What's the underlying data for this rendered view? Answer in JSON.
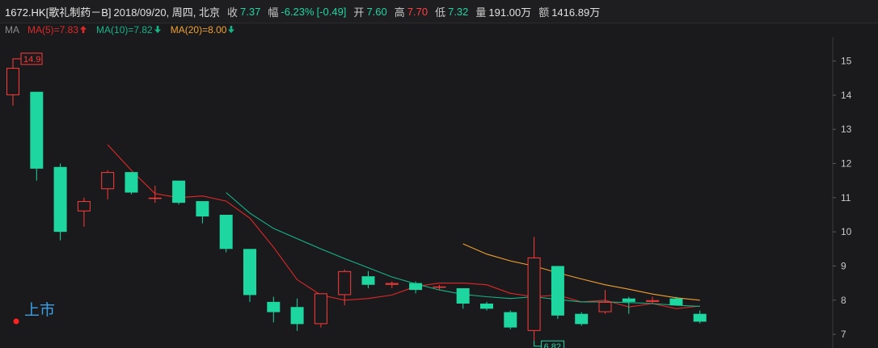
{
  "header": {
    "title": "1672.HK[歌礼制药－B]",
    "date": "2018/09/20, 周四, 北京",
    "close_label": "收",
    "close_value": "7.37",
    "change_label": "幅",
    "change_pct": "-6.23%",
    "change_abs": "[-0.49]",
    "open_label": "开",
    "open_value": "7.60",
    "high_label": "高",
    "high_value": "7.70",
    "low_label": "低",
    "low_value": "7.32",
    "volume_label": "量",
    "volume_value": "191.00万",
    "amount_label": "额",
    "amount_value": "1416.89万"
  },
  "ma_bar": {
    "tag": "MA",
    "ma5": "MA(5)=7.83",
    "ma10": "MA(10)=7.82",
    "ma20": "MA(20)=8.00"
  },
  "colors": {
    "up": "#ff3b3b",
    "down": "#1ed6a0",
    "ma5": "#e02828",
    "ma10": "#16b386",
    "ma20": "#f0a030",
    "background": "#1a1a1c",
    "axis_text": "#c8c8c8"
  },
  "annotations": {
    "listing_label": "上市",
    "max_label": "14.9",
    "min_label": "6.82"
  },
  "chart_data": {
    "type": "candlestick",
    "ylim": [
      6.6,
      15.7
    ],
    "yticks": [
      7,
      8,
      9,
      10,
      11,
      12,
      13,
      14,
      15
    ],
    "grid": false,
    "candles": [
      {
        "o": 14.0,
        "h": 14.9,
        "l": 13.7,
        "c": 14.8
      },
      {
        "o": 14.1,
        "h": 14.1,
        "l": 11.5,
        "c": 11.85
      },
      {
        "o": 11.9,
        "h": 12.0,
        "l": 9.75,
        "c": 10.0
      },
      {
        "o": 10.6,
        "h": 11.0,
        "l": 10.15,
        "c": 10.9
      },
      {
        "o": 11.25,
        "h": 11.8,
        "l": 10.95,
        "c": 11.75
      },
      {
        "o": 11.75,
        "h": 11.75,
        "l": 11.1,
        "c": 11.15
      },
      {
        "o": 11.0,
        "h": 11.35,
        "l": 10.85,
        "c": 11.0
      },
      {
        "o": 11.5,
        "h": 11.5,
        "l": 10.8,
        "c": 10.85
      },
      {
        "o": 10.9,
        "h": 10.9,
        "l": 10.25,
        "c": 10.45
      },
      {
        "o": 10.5,
        "h": 10.5,
        "l": 9.4,
        "c": 9.5
      },
      {
        "o": 9.5,
        "h": 9.5,
        "l": 7.95,
        "c": 8.15
      },
      {
        "o": 7.95,
        "h": 8.1,
        "l": 7.35,
        "c": 7.65
      },
      {
        "o": 7.8,
        "h": 8.05,
        "l": 7.1,
        "c": 7.3
      },
      {
        "o": 7.3,
        "h": 8.2,
        "l": 7.2,
        "c": 8.2
      },
      {
        "o": 8.15,
        "h": 8.9,
        "l": 7.85,
        "c": 8.85
      },
      {
        "o": 8.7,
        "h": 8.85,
        "l": 8.35,
        "c": 8.45
      },
      {
        "o": 8.45,
        "h": 8.55,
        "l": 8.35,
        "c": 8.5
      },
      {
        "o": 8.5,
        "h": 8.55,
        "l": 8.2,
        "c": 8.3
      },
      {
        "o": 8.4,
        "h": 8.45,
        "l": 8.3,
        "c": 8.4
      },
      {
        "o": 8.35,
        "h": 8.35,
        "l": 7.75,
        "c": 7.9
      },
      {
        "o": 7.9,
        "h": 7.95,
        "l": 7.7,
        "c": 7.75
      },
      {
        "o": 7.65,
        "h": 7.7,
        "l": 7.15,
        "c": 7.2
      },
      {
        "o": 7.1,
        "h": 9.85,
        "l": 6.82,
        "c": 9.25
      },
      {
        "o": 9.0,
        "h": 9.0,
        "l": 7.45,
        "c": 7.55
      },
      {
        "o": 7.6,
        "h": 7.65,
        "l": 7.25,
        "c": 7.3
      },
      {
        "o": 7.65,
        "h": 8.3,
        "l": 7.6,
        "c": 7.95
      },
      {
        "o": 8.05,
        "h": 8.1,
        "l": 7.6,
        "c": 7.95
      },
      {
        "o": 7.95,
        "h": 8.1,
        "l": 7.9,
        "c": 8.0
      },
      {
        "o": 8.05,
        "h": 8.1,
        "l": 7.85,
        "c": 7.85
      },
      {
        "o": 7.6,
        "h": 7.7,
        "l": 7.32,
        "c": 7.37
      }
    ],
    "series": [
      {
        "name": "MA(5)",
        "start": 4,
        "values": [
          12.55,
          11.8,
          11.12,
          11.0,
          11.05,
          10.9,
          10.4,
          9.55,
          8.6,
          8.15,
          8.0,
          8.05,
          8.15,
          8.4,
          8.5,
          8.5,
          8.45,
          8.2,
          8.1,
          8.15,
          7.95,
          8.0,
          7.8,
          7.9,
          7.75,
          7.83
        ]
      },
      {
        "name": "MA(10)",
        "start": 9,
        "values": [
          11.15,
          10.55,
          10.1,
          9.8,
          9.5,
          9.22,
          8.95,
          8.68,
          8.48,
          8.3,
          8.17,
          8.1,
          8.05,
          8.1,
          8.02,
          7.95,
          7.95,
          7.93,
          7.9,
          7.85,
          7.82
        ]
      },
      {
        "name": "MA(20)",
        "start": 19,
        "values": [
          9.65,
          9.35,
          9.15,
          9.0,
          8.8,
          8.62,
          8.45,
          8.32,
          8.18,
          8.07,
          8.0
        ]
      }
    ]
  }
}
